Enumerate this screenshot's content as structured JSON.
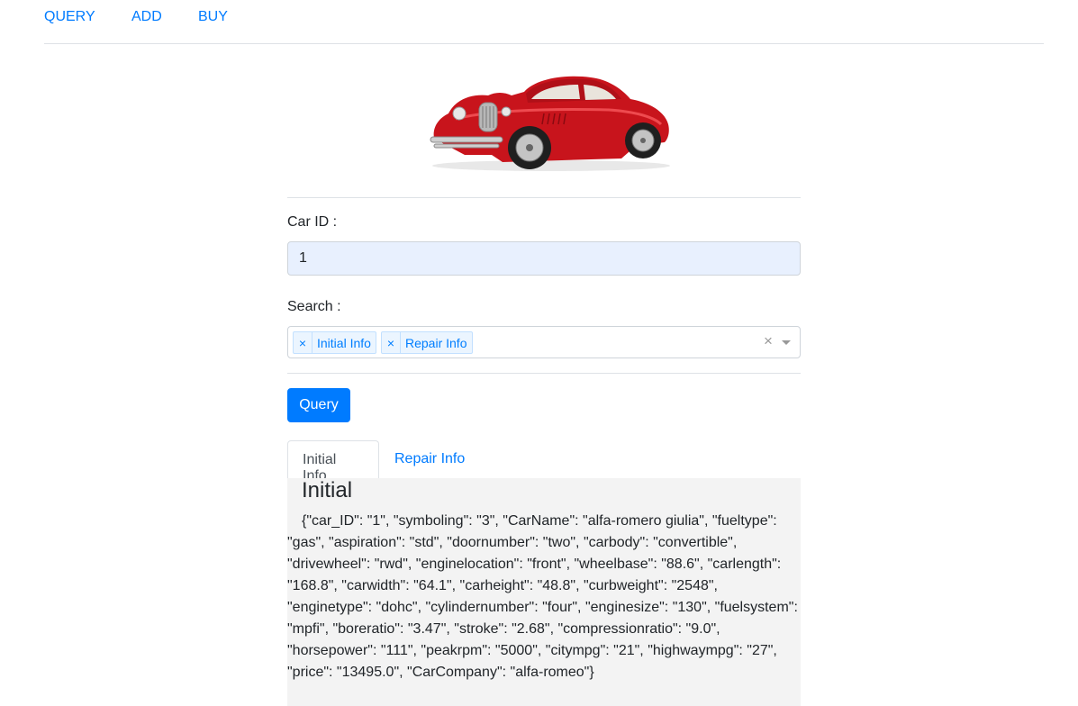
{
  "nav": {
    "items": [
      {
        "label": "QUERY"
      },
      {
        "label": "ADD"
      },
      {
        "label": "BUY"
      }
    ]
  },
  "form": {
    "car_id_label": "Car ID :",
    "car_id_value": "1",
    "search_label": "Search :",
    "search_tags": [
      {
        "label": "Initial Info",
        "remove": "×"
      },
      {
        "label": "Repair Info",
        "remove": "×"
      }
    ],
    "clear_symbol": "×",
    "query_button": "Query"
  },
  "tabs": [
    {
      "label": "Initial Info",
      "active": true
    },
    {
      "label": "Repair Info",
      "active": false
    }
  ],
  "panel": {
    "title": "Initial",
    "content": "{\"car_ID\": \"1\", \"symboling\": \"3\", \"CarName\": \"alfa-romero giulia\", \"fueltype\": \"gas\", \"aspiration\": \"std\", \"doornumber\": \"two\", \"carbody\": \"convertible\", \"drivewheel\": \"rwd\", \"enginelocation\": \"front\", \"wheelbase\": \"88.6\", \"carlength\": \"168.8\", \"carwidth\": \"64.1\", \"carheight\": \"48.8\", \"curbweight\": \"2548\", \"enginetype\": \"dohc\", \"cylindernumber\": \"four\", \"enginesize\": \"130\", \"fuelsystem\": \"mpfi\", \"boreratio\": \"3.47\", \"stroke\": \"2.68\", \"compressionratio\": \"9.0\", \"horsepower\": \"111\", \"peakrpm\": \"5000\", \"citympg\": \"21\", \"highwaympg\": \"27\", \"price\": \"13495.0\", \"CarCompany\": \"alfa-romeo\"}"
  },
  "colors": {
    "link": "#007bff",
    "button_bg": "#007bff",
    "input_autofill_bg": "#e8f0fe",
    "tag_bg": "#ebf5ff",
    "tag_text": "#007eff",
    "panel_bg": "#f3f3f3"
  }
}
